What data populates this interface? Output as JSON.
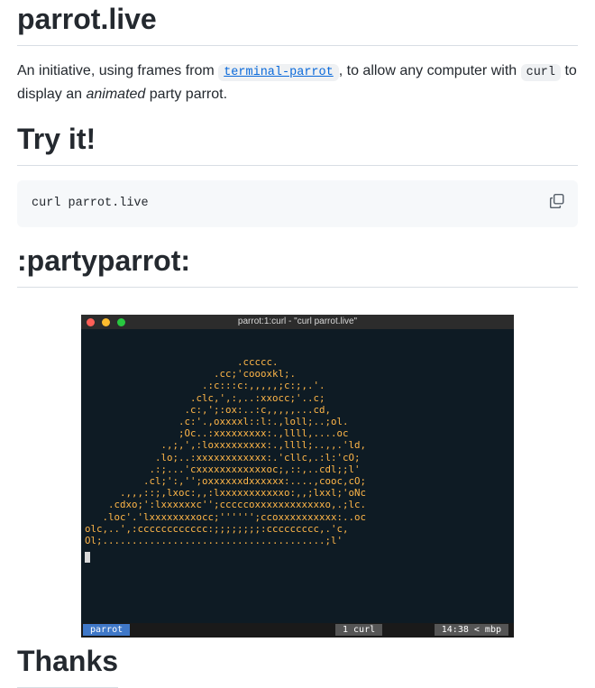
{
  "headings": {
    "site": "parrot.live",
    "try": "Try it!",
    "party": ":partyparrot:",
    "next": "Thanks"
  },
  "intro": {
    "part1": "An initiative, using frames from ",
    "terminal_parrot": "terminal-parrot",
    "part2": ", to allow any computer with ",
    "curl": "curl",
    "part3": " to display an ",
    "animated": "animated",
    "part4": " party parrot."
  },
  "code": {
    "command": "curl parrot.live",
    "copy_icon": "copy-icon"
  },
  "terminal": {
    "title": "parrot:1:curl - \"curl parrot.live\"",
    "ascii": "                          .ccccc.\n                      .cc;'coooxkl;.\n                    .:c:::c:,,,,,;c:;,.'.\n                  .clc,',:,..:xxocc;'..c;\n                 .c:,';:ox:..:c,,,,,...cd,\n                .c:'.,oxxxxl::l:.,loll;..;ol.\n                ;Oc..:xxxxxxxxx:.,llll,....oc\n             .,;,',:loxxxxxxxxx:.,llll;..,,.'ld,\n            .lo;..:xxxxxxxxxxxx:.'cllc,.:l:'cO;\n           .:;...'cxxxxxxxxxxxxoc;,::,..cdl;;l'\n          .cl;':,'';oxxxxxxdxxxxxx:....,cooc,cO;\n      .,,,::;,lxoc:,,:lxxxxxxxxxxxo:,,;lxxl;'oNc\n    .cdxo;':lxxxxxxc'';cccccoxxxxxxxxxxxxo,.;lc.\n   .loc'.'lxxxxxxxxocc;'''''';ccoxxxxxxxxxx:..oc\nolc,..',:cccccccccccc:;;;;;;;;:ccccccccc,.'c,\nOl;......................................;l'",
    "status_session": "parrot",
    "status_window": "1 curl",
    "status_clock": "14:38 < mbp",
    "colors": {
      "bg": "#0e1b24",
      "text": "#ffb648",
      "close": "#ff5f57",
      "minimize": "#febc2e",
      "zoom": "#28c840"
    }
  }
}
